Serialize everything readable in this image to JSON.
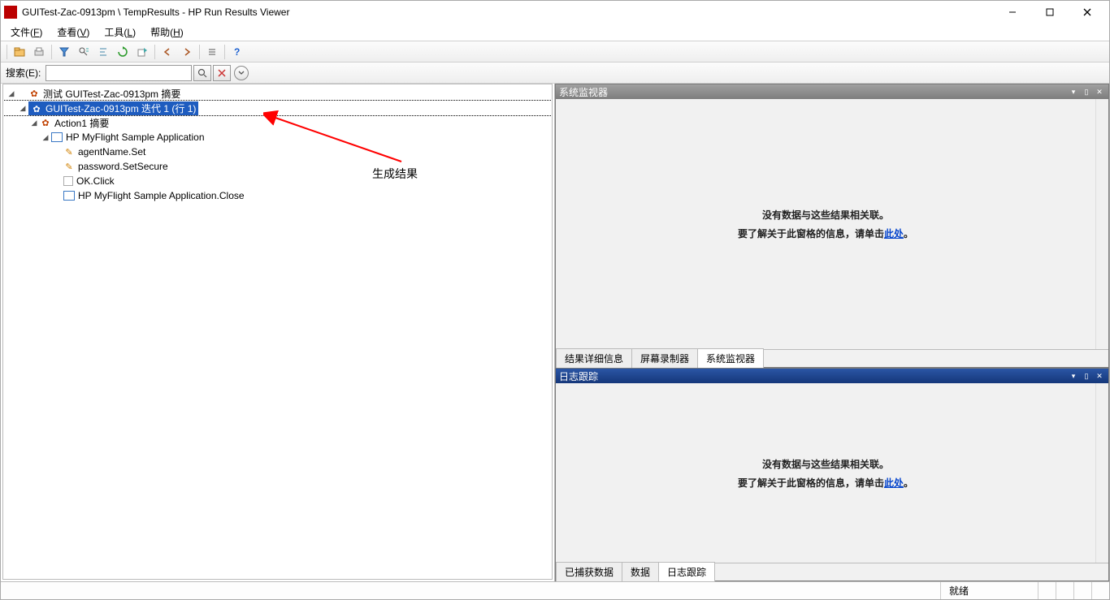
{
  "window": {
    "title": "GUITest-Zac-0913pm \\ TempResults - HP Run Results Viewer"
  },
  "menu": {
    "file": {
      "label": "文件",
      "accel": "F"
    },
    "view": {
      "label": "查看",
      "accel": "V"
    },
    "tools": {
      "label": "工具",
      "accel": "L"
    },
    "help": {
      "label": "帮助",
      "accel": "H"
    }
  },
  "search": {
    "label": "搜索(E):"
  },
  "tree": {
    "n0": "测试 GUITest-Zac-0913pm 摘要",
    "n1": "GUITest-Zac-0913pm 迭代 1 (行 1)",
    "n2": "Action1 摘要",
    "n3": "HP MyFlight Sample Application",
    "n4": "agentName.Set",
    "n5": "password.SetSecure",
    "n6": "OK.Click",
    "n7": "HP MyFlight Sample Application.Close"
  },
  "annotation": "生成结果",
  "panels": {
    "sysmon": {
      "title": "系统监视器"
    },
    "log": {
      "title": "日志跟踪"
    },
    "msg1": "没有数据与这些结果相关联。",
    "msg2_prefix": "要了解关于此窗格的信息，请单击",
    "msg2_link": "此处",
    "msg2_suffix": "。"
  },
  "tabs_upper": {
    "t1": "结果详细信息",
    "t2": "屏幕录制器",
    "t3": "系统监视器"
  },
  "tabs_lower": {
    "t1": "已捕获数据",
    "t2": "数据",
    "t3": "日志跟踪"
  },
  "status": {
    "ready": "就绪"
  }
}
